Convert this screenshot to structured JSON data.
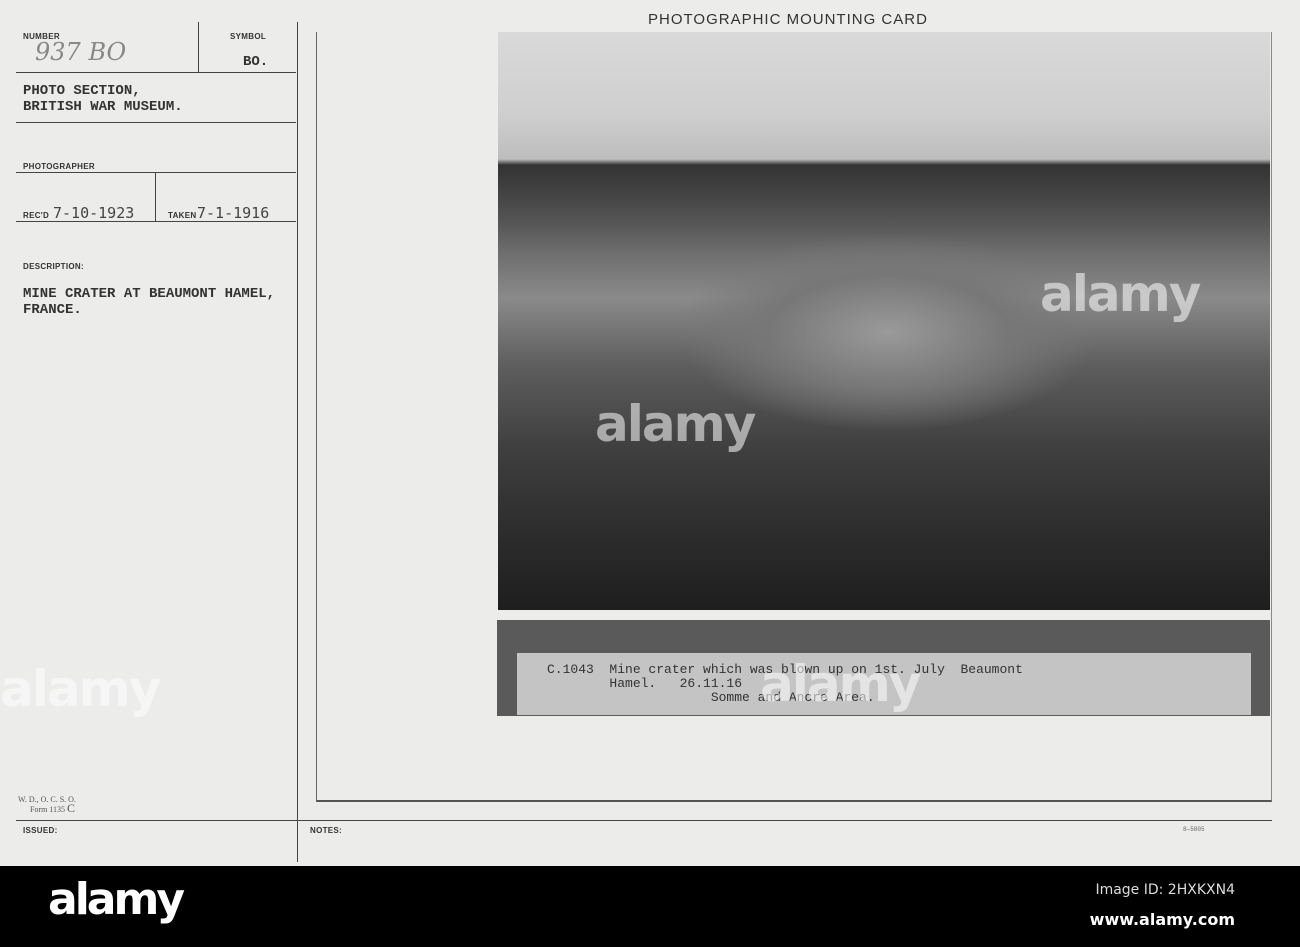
{
  "header": {
    "title": "PHOTOGRAPHIC MOUNTING CARD"
  },
  "left": {
    "number_label": "NUMBER",
    "number_value": "937 BO",
    "symbol_label": "SYMBOL",
    "symbol_value": "BO.",
    "section_line1": "PHOTO SECTION,",
    "section_line2": "BRITISH WAR MUSEUM.",
    "photographer_label": "PHOTOGRAPHER",
    "recd_label": "REC'D",
    "recd_value": "7-10-1923",
    "taken_label": "TAKEN",
    "taken_value": "7-1-1916",
    "description_label": "DESCRIPTION:",
    "description_line1": "MINE CRATER AT BEAUMONT HAMEL,",
    "description_line2": "FRANCE.",
    "form_line1": "W. D., O. C. S. O.",
    "form_line2": "Form 1135",
    "form_suffix": "C",
    "issued_label": "ISSUED:"
  },
  "notes_label": "NOTES:",
  "print_code": "8—5805",
  "caption": {
    "line1": "C.1043  Mine crater which was blown up on 1st. July  Beaumont",
    "line2": "        Hamel.   26.11.16",
    "line3": "                     Somme and Ancre Area."
  },
  "footer": {
    "logo": "alamy",
    "image_id": "Image ID: 2HXKXN4",
    "url": "www.alamy.com"
  }
}
